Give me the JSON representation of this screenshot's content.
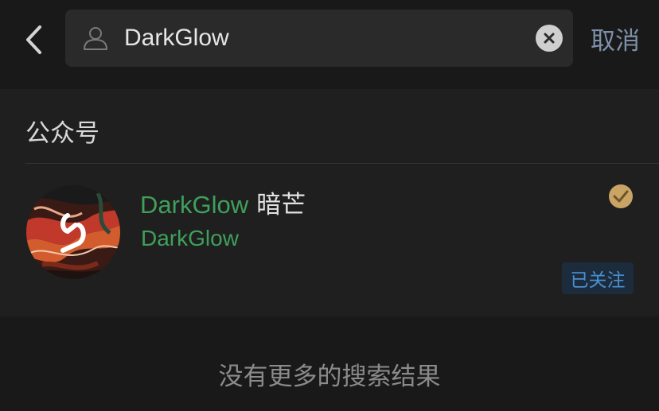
{
  "header": {
    "back_icon": "chevron-left-icon",
    "search": {
      "icon": "user-silhouette-icon",
      "value": "DarkGlow",
      "clear_icon": "clear-circle-x-icon"
    },
    "cancel_label": "取消"
  },
  "results": {
    "section_title": "公众号",
    "account": {
      "avatar_icon": "marbled-logo-avatar",
      "name_highlight": "DarkGlow",
      "name_rest": "暗芒",
      "account_id": "DarkGlow",
      "verified_icon": "verified-check-icon",
      "follow_status": "已关注"
    }
  },
  "footer": {
    "no_more_text": "没有更多的搜索结果"
  },
  "colors": {
    "background": "#1f1f1f",
    "header_background": "#191919",
    "search_box": "#2a2a2a",
    "highlight_green": "#3fa05a",
    "cancel_blue": "#7d90a9",
    "verified_gold": "#c9a464",
    "follow_badge_text": "#4a8fd0",
    "follow_badge_bg": "#1c2c3c"
  }
}
